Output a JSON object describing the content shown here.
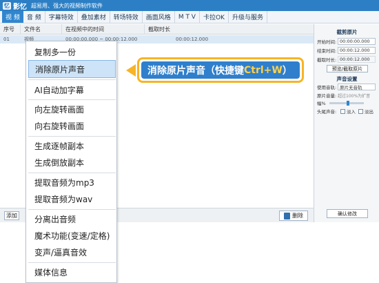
{
  "app": {
    "name": "影忆",
    "slogan": "超易用、强大的视频制作软件",
    "logo_text": "忆"
  },
  "menu": [
    {
      "label": "视 频",
      "active": true
    },
    {
      "label": "音 频",
      "active": false
    },
    {
      "label": "字幕特效",
      "active": false
    },
    {
      "label": "叠加素材",
      "active": false
    },
    {
      "label": "转场特效",
      "active": false
    },
    {
      "label": "画面风格",
      "active": false
    },
    {
      "label": "M T V",
      "active": false
    },
    {
      "label": "卡拉OK",
      "active": false
    },
    {
      "label": "升级与服务",
      "active": false
    }
  ],
  "list": {
    "columns": [
      "序号",
      "文件名",
      "在视频中的时间",
      "截取时长"
    ],
    "rows": [
      {
        "index": "01",
        "name": "视频",
        "time": "00:00:00.000 ~ 00:00:12.000",
        "duration": "00:00:12.000"
      }
    ]
  },
  "bottom": {
    "add_label": "添加",
    "delete_label": "删除"
  },
  "right_panel": {
    "cut_title": "截剪原片",
    "start_label": "开始时间:",
    "start_value": "00:00:00.000",
    "end_label": "结束时间:",
    "end_value": "00:00:12.000",
    "cut_duration_label": "截取时长:",
    "cut_duration_value": "00:00:12.000",
    "preview_button": "预览/截取原片",
    "audio_title": "声音设置",
    "track_label": "使用音轨:",
    "track_value": "原片无音轨",
    "volume_label": "原片音量:",
    "volume_hint": "超过100%为扩音",
    "fade_label_short": "幅%",
    "fade_row_label": "头尾声音:",
    "fade_in": "淡入",
    "fade_out": "淡出",
    "confirm_button": "确认修改"
  },
  "context_menu": [
    "复制多一份",
    "消除原片声音",
    "AI自动加字幕",
    "向左旋转画面",
    "向右旋转画面",
    "生成逐帧副本",
    "生成倒放副本",
    "提取音频为mp3",
    "提取音频为wav",
    "分离出音频",
    "魔术功能(变速/定格)",
    "变声/逼真音效",
    "媒体信息"
  ],
  "callout": {
    "text": "消除原片声音（快捷键",
    "shortcut": "Ctrl+W",
    "close": "）"
  },
  "colors": {
    "accent": "#2f7fcc",
    "highlight": "#cde3f7",
    "callout_border": "#f7b426",
    "shortcut_text": "#ffd24a"
  }
}
